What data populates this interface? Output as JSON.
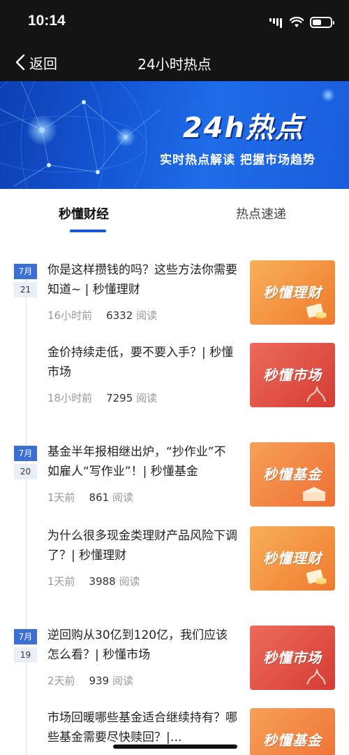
{
  "status_bar": {
    "time": "10:14"
  },
  "nav": {
    "back_label": "返回",
    "title": "24小时热点"
  },
  "banner": {
    "title": "24h热点",
    "subtitle": "实时热点解读  把握市场趋势"
  },
  "tabs": [
    {
      "label": "秒懂财经",
      "active": true
    },
    {
      "label": "热点速递",
      "active": false
    }
  ],
  "groups": [
    {
      "month": "7月",
      "day": "21",
      "articles": [
        {
          "title": "你是这样攒钱的吗？这些方法你需要知道~ | 秒懂理财",
          "time": "16小时前",
          "views": "6332",
          "views_suffix": "阅读",
          "thumb_label": "秒懂理财",
          "thumb_colors": [
            "#f7b05a",
            "#f07a2e"
          ],
          "thumb_icon": "coins-icon"
        },
        {
          "title": "金价持续走低，要不要入手？| 秒懂市场",
          "time": "18小时前",
          "views": "7295",
          "views_suffix": "阅读",
          "thumb_label": "秒懂市场",
          "thumb_colors": [
            "#ec6b5c",
            "#d63c33"
          ],
          "thumb_icon": "market-chart-icon"
        }
      ]
    },
    {
      "month": "7月",
      "day": "20",
      "articles": [
        {
          "title": "基金半年报相继出炉，“抄作业”不如雇人“写作业”！| 秒懂基金",
          "time": "1天前",
          "views": "861",
          "views_suffix": "阅读",
          "thumb_label": "秒懂基金",
          "thumb_colors": [
            "#f6a158",
            "#ef6f35"
          ],
          "thumb_icon": "fund-icon"
        },
        {
          "title": "为什么很多现金类理财产品风险下调了？| 秒懂理财",
          "time": "1天前",
          "views": "3988",
          "views_suffix": "阅读",
          "thumb_label": "秒懂理财",
          "thumb_colors": [
            "#f7b05a",
            "#f07a2e"
          ],
          "thumb_icon": "coins-icon"
        }
      ]
    },
    {
      "month": "7月",
      "day": "19",
      "articles": [
        {
          "title": "逆回购从30亿到120亿，我们应该怎么看？| 秒懂市场",
          "time": "2天前",
          "views": "939",
          "views_suffix": "阅读",
          "thumb_label": "秒懂市场",
          "thumb_colors": [
            "#ec6b5c",
            "#d63c33"
          ],
          "thumb_icon": "market-chart-icon"
        },
        {
          "title": "市场回暖哪些基金适合继续持有？哪些基金需要尽快赎回？|…",
          "time": "",
          "views": "",
          "views_suffix": "",
          "thumb_label": "秒懂基金",
          "thumb_colors": [
            "#f6a158",
            "#ef6f35"
          ],
          "thumb_icon": "fund-icon"
        }
      ]
    }
  ],
  "colors": {
    "accent": "#1a57d6",
    "nav_bg": "#141414"
  }
}
